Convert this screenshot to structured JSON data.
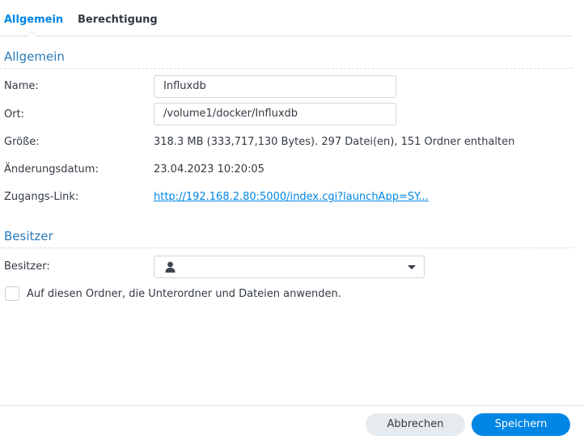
{
  "tabs": [
    {
      "label": "Allgemein",
      "active": true
    },
    {
      "label": "Berechtigung",
      "active": false
    }
  ],
  "general": {
    "section_title": "Allgemein",
    "name_label": "Name:",
    "name_value": "Influxdb",
    "location_label": "Ort:",
    "location_value": "/volume1/docker/Influxdb",
    "size_label": "Größe:",
    "size_value": "318.3 MB (333,717,130 Bytes). 297 Datei(en), 151 Ordner enthalten",
    "modified_label": "Änderungsdatum:",
    "modified_value": "23.04.2023 10:20:05",
    "link_label": "Zugangs-Link:",
    "link_value": "http://192.168.2.80:5000/index.cgi?launchApp=SY..."
  },
  "owner": {
    "section_title": "Besitzer",
    "owner_label": "Besitzer:",
    "owner_value": "",
    "owner_icon": "user-icon",
    "apply_checkbox_label": "Auf diesen Ordner, die Unterordner und Dateien anwenden.",
    "apply_checked": false
  },
  "footer": {
    "cancel_label": "Abbrechen",
    "save_label": "Speichern"
  },
  "colors": {
    "accent": "#0086e5",
    "section_title": "#2a7ab8",
    "text": "#333a44"
  }
}
